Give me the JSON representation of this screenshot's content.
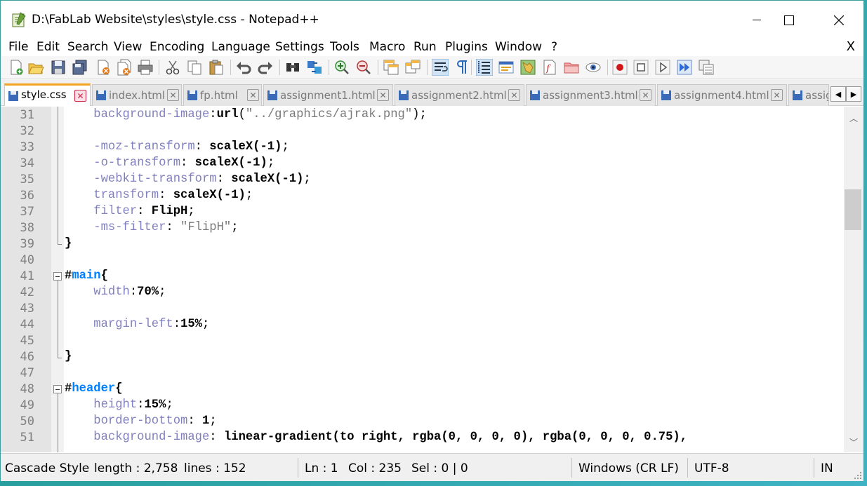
{
  "window": {
    "title": "D:\\FabLab Website\\styles\\style.css - Notepad++"
  },
  "menu": {
    "items": [
      "File",
      "Edit",
      "Search",
      "View",
      "Encoding",
      "Language",
      "Settings",
      "Tools",
      "Macro",
      "Run",
      "Plugins",
      "Window",
      "?"
    ],
    "close_label": "X"
  },
  "tabs": [
    {
      "label": "style.css",
      "active": true
    },
    {
      "label": "index.html",
      "active": false
    },
    {
      "label": "fp.html",
      "active": false
    },
    {
      "label": "assignment1.html",
      "active": false
    },
    {
      "label": "assignment2.html",
      "active": false
    },
    {
      "label": "assignment3.html",
      "active": false
    },
    {
      "label": "assignment4.html",
      "active": false
    },
    {
      "label": "assig",
      "active": false
    }
  ],
  "tab_scroll": {
    "left": "◀",
    "right": "▶"
  },
  "editor": {
    "lines": [
      {
        "n": "31",
        "tokens": [
          [
            "prop",
            "    background-image"
          ],
          [
            "punct",
            ":"
          ],
          [
            "val",
            "url"
          ],
          [
            "punct",
            "("
          ],
          [
            "str",
            "\"../graphics/ajrak.png\""
          ],
          [
            "punct",
            ");"
          ]
        ]
      },
      {
        "n": "32",
        "tokens": []
      },
      {
        "n": "33",
        "tokens": [
          [
            "prop",
            "    -moz-transform"
          ],
          [
            "punct",
            ": "
          ],
          [
            "val",
            "scaleX(-1)"
          ],
          [
            "punct",
            ";"
          ]
        ]
      },
      {
        "n": "34",
        "tokens": [
          [
            "prop",
            "    -o-transform"
          ],
          [
            "punct",
            ": "
          ],
          [
            "val",
            "scaleX(-1)"
          ],
          [
            "punct",
            ";"
          ]
        ]
      },
      {
        "n": "35",
        "tokens": [
          [
            "prop",
            "    -webkit-transform"
          ],
          [
            "punct",
            ": "
          ],
          [
            "val",
            "scaleX(-1)"
          ],
          [
            "punct",
            ";"
          ]
        ]
      },
      {
        "n": "36",
        "tokens": [
          [
            "prop",
            "    transform"
          ],
          [
            "punct",
            ": "
          ],
          [
            "val",
            "scaleX(-1)"
          ],
          [
            "punct",
            ";"
          ]
        ]
      },
      {
        "n": "37",
        "tokens": [
          [
            "prop",
            "    filter"
          ],
          [
            "punct",
            ": "
          ],
          [
            "val",
            "FlipH"
          ],
          [
            "punct",
            ";"
          ]
        ]
      },
      {
        "n": "38",
        "tokens": [
          [
            "prop",
            "    -ms-filter"
          ],
          [
            "punct",
            ": "
          ],
          [
            "str",
            "\"FlipH\""
          ],
          [
            "punct",
            ";"
          ]
        ]
      },
      {
        "n": "39",
        "tokens": [
          [
            "brace",
            "}"
          ]
        ]
      },
      {
        "n": "40",
        "tokens": []
      },
      {
        "n": "41",
        "tokens": [
          [
            "brace",
            "#"
          ],
          [
            "sel",
            "main"
          ],
          [
            "brace",
            "{"
          ]
        ]
      },
      {
        "n": "42",
        "tokens": [
          [
            "prop",
            "    width"
          ],
          [
            "punct",
            ":"
          ],
          [
            "val",
            "70%"
          ],
          [
            "punct",
            ";"
          ]
        ]
      },
      {
        "n": "43",
        "tokens": []
      },
      {
        "n": "44",
        "tokens": [
          [
            "prop",
            "    margin-left"
          ],
          [
            "punct",
            ":"
          ],
          [
            "val",
            "15%"
          ],
          [
            "punct",
            ";"
          ]
        ]
      },
      {
        "n": "45",
        "tokens": []
      },
      {
        "n": "46",
        "tokens": [
          [
            "brace",
            "}"
          ]
        ]
      },
      {
        "n": "47",
        "tokens": []
      },
      {
        "n": "48",
        "tokens": [
          [
            "brace",
            "#"
          ],
          [
            "sel",
            "header"
          ],
          [
            "brace",
            "{"
          ]
        ]
      },
      {
        "n": "49",
        "tokens": [
          [
            "prop",
            "    height"
          ],
          [
            "punct",
            ":"
          ],
          [
            "val",
            "15%"
          ],
          [
            "punct",
            ";"
          ]
        ]
      },
      {
        "n": "50",
        "tokens": [
          [
            "prop",
            "    border-bottom"
          ],
          [
            "punct",
            ": "
          ],
          [
            "val",
            "1"
          ],
          [
            "punct",
            ";"
          ]
        ]
      },
      {
        "n": "51",
        "tokens": [
          [
            "prop",
            "    background-image"
          ],
          [
            "punct",
            ": "
          ],
          [
            "val",
            "linear-gradient(to right, rgba(0, 0, 0, 0), rgba(0, 0, 0, 0.75),"
          ]
        ]
      }
    ]
  },
  "status": {
    "language": "Cascade Style S",
    "length": "length : 2,758",
    "lines": "lines : 152",
    "ln": "Ln : 1",
    "col": "Col : 235",
    "sel": "Sel : 0 | 0",
    "eol": "Windows (CR LF)",
    "encoding": "UTF-8",
    "mode": "IN"
  },
  "colors": {
    "property": "#8080c0",
    "selector": "#0080ff",
    "active_tab_accent": "#f4a31e"
  }
}
